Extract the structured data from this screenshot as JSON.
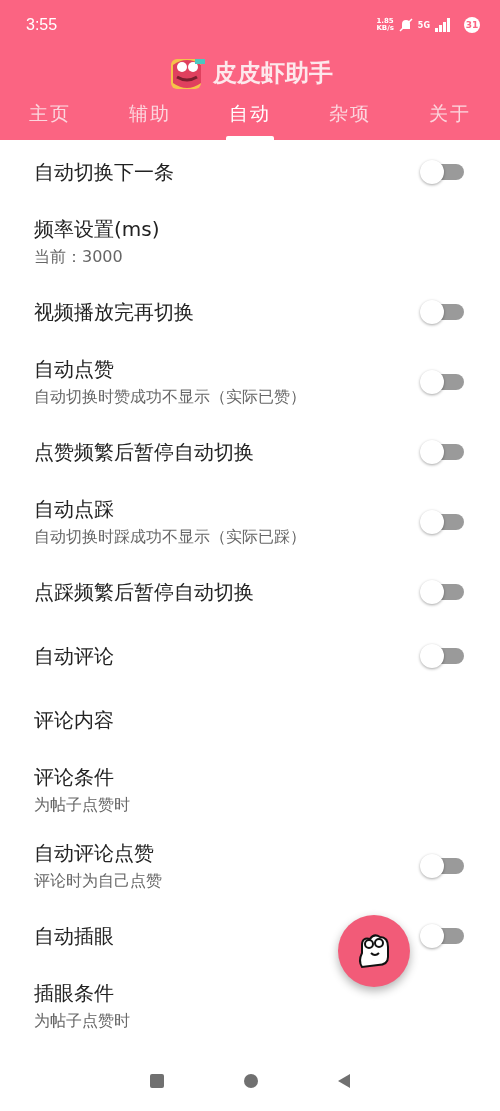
{
  "status_bar": {
    "time": "3:55",
    "speed": "1.85\nKB/s",
    "network": "5G",
    "battery": "31"
  },
  "app_title": "皮皮虾助手",
  "tabs": [
    {
      "label": "主页",
      "selected": false
    },
    {
      "label": "辅助",
      "selected": false
    },
    {
      "label": "自动",
      "selected": true
    },
    {
      "label": "杂项",
      "selected": false
    },
    {
      "label": "关于",
      "selected": false
    }
  ],
  "settings": [
    {
      "kind": "switch",
      "title": "自动切换下一条",
      "on": false
    },
    {
      "kind": "text",
      "title": "频率设置(ms)",
      "summary": "当前：3000"
    },
    {
      "kind": "switch",
      "title": "视频播放完再切换",
      "on": false
    },
    {
      "kind": "switch",
      "title": "自动点赞",
      "summary": "自动切换时赞成功不显示（实际已赞）",
      "on": false
    },
    {
      "kind": "switch",
      "title": "点赞频繁后暂停自动切换",
      "on": false
    },
    {
      "kind": "switch",
      "title": "自动点踩",
      "summary": "自动切换时踩成功不显示（实际已踩）",
      "on": false
    },
    {
      "kind": "switch",
      "title": "点踩频繁后暂停自动切换",
      "on": false
    },
    {
      "kind": "switch",
      "title": "自动评论",
      "on": false
    },
    {
      "kind": "text",
      "title": "评论内容"
    },
    {
      "kind": "text",
      "title": "评论条件",
      "summary": "为帖子点赞时"
    },
    {
      "kind": "switch",
      "title": "自动评论点赞",
      "summary": "评论时为自己点赞",
      "on": false
    },
    {
      "kind": "switch",
      "title": "自动插眼",
      "on": false
    },
    {
      "kind": "text",
      "title": "插眼条件",
      "summary": "为帖子点赞时"
    }
  ]
}
